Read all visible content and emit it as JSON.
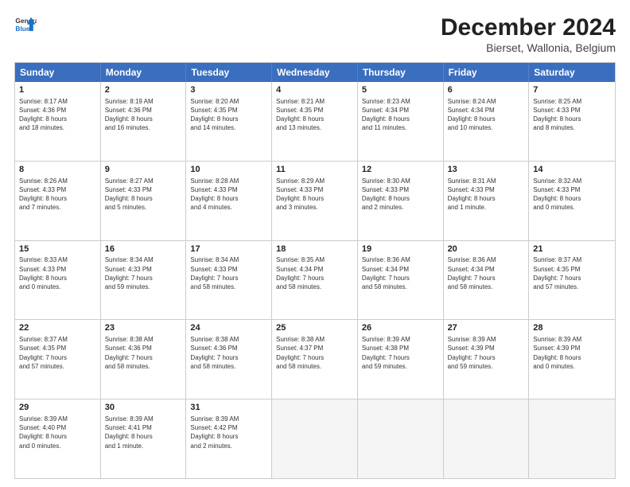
{
  "header": {
    "logo_line1": "General",
    "logo_line2": "Blue",
    "title": "December 2024",
    "subtitle": "Bierset, Wallonia, Belgium"
  },
  "calendar": {
    "days_of_week": [
      "Sunday",
      "Monday",
      "Tuesday",
      "Wednesday",
      "Thursday",
      "Friday",
      "Saturday"
    ],
    "rows": [
      [
        {
          "day": "1",
          "info": "Sunrise: 8:17 AM\nSunset: 4:36 PM\nDaylight: 8 hours\nand 18 minutes."
        },
        {
          "day": "2",
          "info": "Sunrise: 8:19 AM\nSunset: 4:36 PM\nDaylight: 8 hours\nand 16 minutes."
        },
        {
          "day": "3",
          "info": "Sunrise: 8:20 AM\nSunset: 4:35 PM\nDaylight: 8 hours\nand 14 minutes."
        },
        {
          "day": "4",
          "info": "Sunrise: 8:21 AM\nSunset: 4:35 PM\nDaylight: 8 hours\nand 13 minutes."
        },
        {
          "day": "5",
          "info": "Sunrise: 8:23 AM\nSunset: 4:34 PM\nDaylight: 8 hours\nand 11 minutes."
        },
        {
          "day": "6",
          "info": "Sunrise: 8:24 AM\nSunset: 4:34 PM\nDaylight: 8 hours\nand 10 minutes."
        },
        {
          "day": "7",
          "info": "Sunrise: 8:25 AM\nSunset: 4:33 PM\nDaylight: 8 hours\nand 8 minutes."
        }
      ],
      [
        {
          "day": "8",
          "info": "Sunrise: 8:26 AM\nSunset: 4:33 PM\nDaylight: 8 hours\nand 7 minutes."
        },
        {
          "day": "9",
          "info": "Sunrise: 8:27 AM\nSunset: 4:33 PM\nDaylight: 8 hours\nand 5 minutes."
        },
        {
          "day": "10",
          "info": "Sunrise: 8:28 AM\nSunset: 4:33 PM\nDaylight: 8 hours\nand 4 minutes."
        },
        {
          "day": "11",
          "info": "Sunrise: 8:29 AM\nSunset: 4:33 PM\nDaylight: 8 hours\nand 3 minutes."
        },
        {
          "day": "12",
          "info": "Sunrise: 8:30 AM\nSunset: 4:33 PM\nDaylight: 8 hours\nand 2 minutes."
        },
        {
          "day": "13",
          "info": "Sunrise: 8:31 AM\nSunset: 4:33 PM\nDaylight: 8 hours\nand 1 minute."
        },
        {
          "day": "14",
          "info": "Sunrise: 8:32 AM\nSunset: 4:33 PM\nDaylight: 8 hours\nand 0 minutes."
        }
      ],
      [
        {
          "day": "15",
          "info": "Sunrise: 8:33 AM\nSunset: 4:33 PM\nDaylight: 8 hours\nand 0 minutes."
        },
        {
          "day": "16",
          "info": "Sunrise: 8:34 AM\nSunset: 4:33 PM\nDaylight: 7 hours\nand 59 minutes."
        },
        {
          "day": "17",
          "info": "Sunrise: 8:34 AM\nSunset: 4:33 PM\nDaylight: 7 hours\nand 58 minutes."
        },
        {
          "day": "18",
          "info": "Sunrise: 8:35 AM\nSunset: 4:34 PM\nDaylight: 7 hours\nand 58 minutes."
        },
        {
          "day": "19",
          "info": "Sunrise: 8:36 AM\nSunset: 4:34 PM\nDaylight: 7 hours\nand 58 minutes."
        },
        {
          "day": "20",
          "info": "Sunrise: 8:36 AM\nSunset: 4:34 PM\nDaylight: 7 hours\nand 58 minutes."
        },
        {
          "day": "21",
          "info": "Sunrise: 8:37 AM\nSunset: 4:35 PM\nDaylight: 7 hours\nand 57 minutes."
        }
      ],
      [
        {
          "day": "22",
          "info": "Sunrise: 8:37 AM\nSunset: 4:35 PM\nDaylight: 7 hours\nand 57 minutes."
        },
        {
          "day": "23",
          "info": "Sunrise: 8:38 AM\nSunset: 4:36 PM\nDaylight: 7 hours\nand 58 minutes."
        },
        {
          "day": "24",
          "info": "Sunrise: 8:38 AM\nSunset: 4:36 PM\nDaylight: 7 hours\nand 58 minutes."
        },
        {
          "day": "25",
          "info": "Sunrise: 8:38 AM\nSunset: 4:37 PM\nDaylight: 7 hours\nand 58 minutes."
        },
        {
          "day": "26",
          "info": "Sunrise: 8:39 AM\nSunset: 4:38 PM\nDaylight: 7 hours\nand 59 minutes."
        },
        {
          "day": "27",
          "info": "Sunrise: 8:39 AM\nSunset: 4:39 PM\nDaylight: 7 hours\nand 59 minutes."
        },
        {
          "day": "28",
          "info": "Sunrise: 8:39 AM\nSunset: 4:39 PM\nDaylight: 8 hours\nand 0 minutes."
        }
      ],
      [
        {
          "day": "29",
          "info": "Sunrise: 8:39 AM\nSunset: 4:40 PM\nDaylight: 8 hours\nand 0 minutes."
        },
        {
          "day": "30",
          "info": "Sunrise: 8:39 AM\nSunset: 4:41 PM\nDaylight: 8 hours\nand 1 minute."
        },
        {
          "day": "31",
          "info": "Sunrise: 8:39 AM\nSunset: 4:42 PM\nDaylight: 8 hours\nand 2 minutes."
        },
        {
          "day": "",
          "info": ""
        },
        {
          "day": "",
          "info": ""
        },
        {
          "day": "",
          "info": ""
        },
        {
          "day": "",
          "info": ""
        }
      ]
    ]
  }
}
